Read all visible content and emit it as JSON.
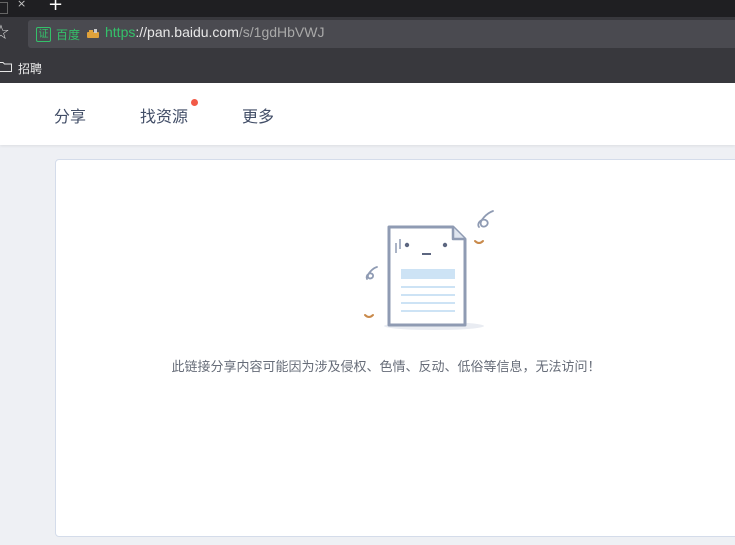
{
  "browser": {
    "tab_close_glyph": "×",
    "new_tab_glyph": "+",
    "cert_glyph": "证",
    "cert_issuer": "百度",
    "url_scheme": "https",
    "url_host": "://pan.baidu.com",
    "url_path": "/s/1gdHbVWJ",
    "bookmark_label": "招聘",
    "star_glyph": "☆"
  },
  "nav": {
    "items": [
      "分享",
      "找资源",
      "更多"
    ],
    "has_notification_on": "找资源"
  },
  "main": {
    "message": "此链接分享内容可能因为涉及侵权、色情、反动、低俗等信息，无法访问！"
  },
  "colors": {
    "secure_green": "#34c16a",
    "notification_dot": "#f25a47",
    "nav_text": "#424e67"
  },
  "icons": [
    "star-icon",
    "cert-icon",
    "secure-icon",
    "folder-icon",
    "tab-close-icon",
    "new-tab-icon",
    "broken-file-illustration"
  ]
}
